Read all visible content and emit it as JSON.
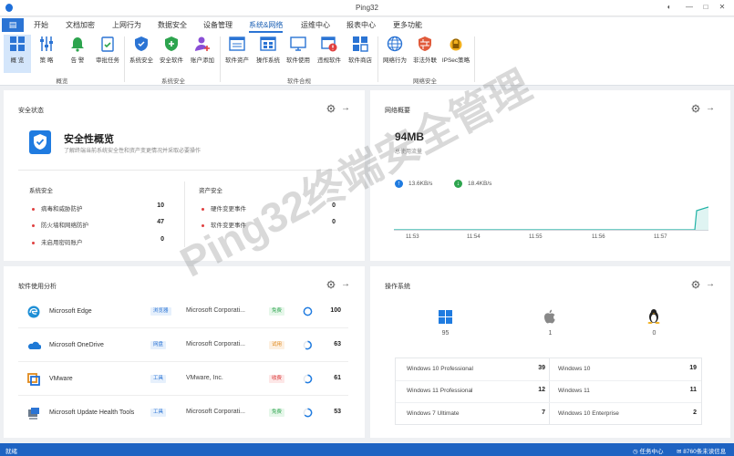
{
  "window": {
    "title": "Ping32"
  },
  "menu": {
    "home_glyph": "▤",
    "items": [
      "开始",
      "文档加密",
      "上网行为",
      "数据安全",
      "设备管理",
      "系统&网络",
      "运维中心",
      "报表中心",
      "更多功能"
    ],
    "active_index": 5
  },
  "ribbon": {
    "buttons": [
      {
        "label": "概 览",
        "icon": "overview-icon"
      },
      {
        "label": "策 略",
        "icon": "sliders-icon"
      },
      {
        "label": "告 警",
        "icon": "bell-icon"
      },
      {
        "label": "审批任务",
        "icon": "clipboard-check-icon"
      },
      {
        "label": "系统安全",
        "icon": "shield-icon"
      },
      {
        "label": "安全软件",
        "icon": "shield-plus-icon"
      },
      {
        "label": "账户添加",
        "icon": "user-add-icon"
      },
      {
        "label": "软件资产",
        "icon": "window-list-icon"
      },
      {
        "label": "操作系统",
        "icon": "window-grid-icon"
      },
      {
        "label": "软件使用",
        "icon": "monitor-icon"
      },
      {
        "label": "违规软件",
        "icon": "window-warning-icon"
      },
      {
        "label": "软件商店",
        "icon": "store-icon"
      },
      {
        "label": "网络行为",
        "icon": "globe-icon"
      },
      {
        "label": "非法外联",
        "icon": "firewall-icon"
      },
      {
        "label": "IPSec策略",
        "icon": "ipsec-lock-icon"
      }
    ],
    "groups": [
      "概览",
      "系统安全",
      "软件合规",
      "网络安全"
    ]
  },
  "security": {
    "title": "安全状态",
    "headline": "安全性概览",
    "subtitle": "了解终端当前系统安全性和资产变更情况并采取必要操作",
    "left_header": "系统安全",
    "left_rows": [
      {
        "label": "病毒和威胁防护",
        "value": "10"
      },
      {
        "label": "防火墙和网络防护",
        "value": "47"
      },
      {
        "label": "未启用密码账户",
        "value": "0"
      }
    ],
    "right_header": "资产安全",
    "right_rows": [
      {
        "label": "硬件变更事件",
        "value": "0"
      },
      {
        "label": "软件变更事件",
        "value": "0"
      }
    ]
  },
  "network": {
    "title": "网络概要",
    "total": "94MB",
    "total_label": "总使用流量",
    "upload": "13.6KB/s",
    "download": "18.4KB/s",
    "accent": "#1f7be0",
    "line_color": "#22b3a6"
  },
  "software": {
    "title": "软件使用分析",
    "rows": [
      {
        "name": "Microsoft Edge",
        "category": "浏览器",
        "cat_color": "blue",
        "vendor": "Microsoft Corporati...",
        "status": "免费",
        "status_color": "green",
        "count": "100",
        "icon": "edge-icon"
      },
      {
        "name": "Microsoft OneDrive",
        "category": "网盘",
        "cat_color": "blue",
        "vendor": "Microsoft Corporati...",
        "status": "试用",
        "status_color": "orange",
        "count": "63",
        "icon": "onedrive-icon"
      },
      {
        "name": "VMware",
        "category": "工具",
        "cat_color": "blue",
        "vendor": "VMware, Inc.",
        "status": "收费",
        "status_color": "red",
        "count": "61",
        "icon": "vmware-icon"
      },
      {
        "name": "Microsoft Update Health Tools",
        "category": "工具",
        "cat_color": "blue",
        "vendor": "Microsoft Corporati...",
        "status": "免费",
        "status_color": "green",
        "count": "53",
        "icon": "update-tools-icon"
      }
    ]
  },
  "os": {
    "title": "操作系统",
    "platforms": [
      {
        "icon": "windows-icon",
        "count": "95"
      },
      {
        "icon": "apple-icon",
        "count": "1"
      },
      {
        "icon": "linux-icon",
        "count": "0"
      }
    ],
    "left": [
      {
        "name": "Windows 10 Professional",
        "count": "39"
      },
      {
        "name": "Windows 11 Professional",
        "count": "12"
      },
      {
        "name": "Windows 7 Ultimate",
        "count": "7"
      }
    ],
    "right": [
      {
        "name": "Windows 10",
        "count": "19"
      },
      {
        "name": "Windows 11",
        "count": "11"
      },
      {
        "name": "Windows 10 Enterprise",
        "count": "2"
      }
    ]
  },
  "status": {
    "left": "就绪",
    "task_center": "任务中心",
    "messages": "8760条未读信息"
  },
  "watermark": "Ping32终端安全管理"
}
